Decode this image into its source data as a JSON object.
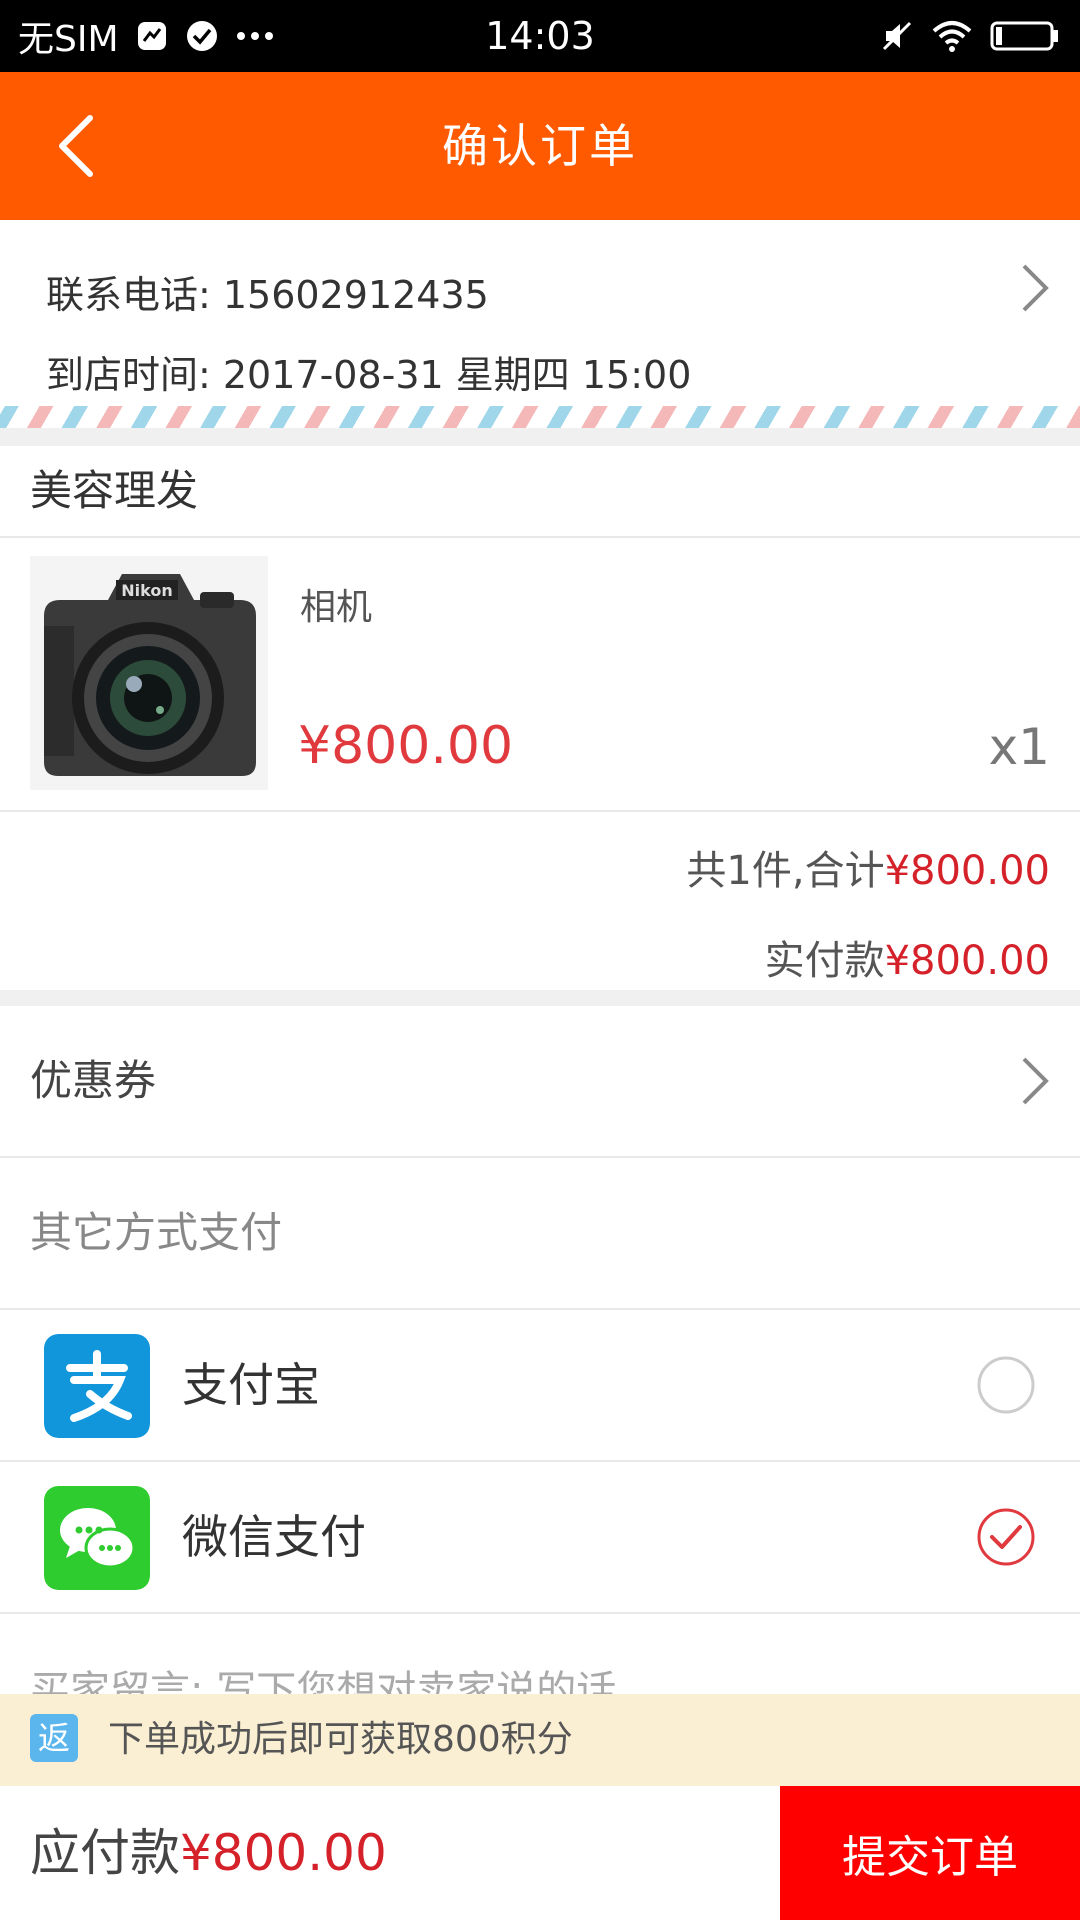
{
  "status_bar": {
    "carrier": "无SIM",
    "time": "14:03",
    "icons": [
      "sim-icon",
      "check-circle-icon",
      "more-dots-icon",
      "mute-icon",
      "wifi-icon",
      "battery-icon"
    ]
  },
  "header": {
    "title": "确认订单",
    "back_icon": "chevron-left-icon",
    "bg_color": "#ff5a00"
  },
  "contact": {
    "phone_label": "联系电话: 15602912435",
    "time_label": "到店时间: 2017-08-31 星期四 15:00"
  },
  "shop": {
    "name": "美容理发"
  },
  "product": {
    "name": "相机",
    "price": "¥800.00",
    "qty": "x1",
    "image": "camera-photo"
  },
  "summary": {
    "count_prefix": "共1件,合计",
    "count_total": "¥800.00",
    "paid_prefix": "实付款",
    "paid_total": "¥800.00"
  },
  "coupon": {
    "label": "优惠券"
  },
  "other_payment": {
    "label": "其它方式支付"
  },
  "payments": [
    {
      "label": "支付宝",
      "icon": "alipay-icon",
      "selected": false
    },
    {
      "label": "微信支付",
      "icon": "wechat-pay-icon",
      "selected": true
    }
  ],
  "message": {
    "placeholder": "买家留言: 写下您想对卖家说的话"
  },
  "banner": {
    "badge": "返",
    "text": "下单成功后即可获取800积分"
  },
  "bottom": {
    "due_label": "应付款",
    "due_amount": "¥800.00",
    "submit_label": "提交订单"
  },
  "colors": {
    "accent": "#ff5a00",
    "price_red": "#d4212a",
    "submit_red": "#ff0000"
  }
}
